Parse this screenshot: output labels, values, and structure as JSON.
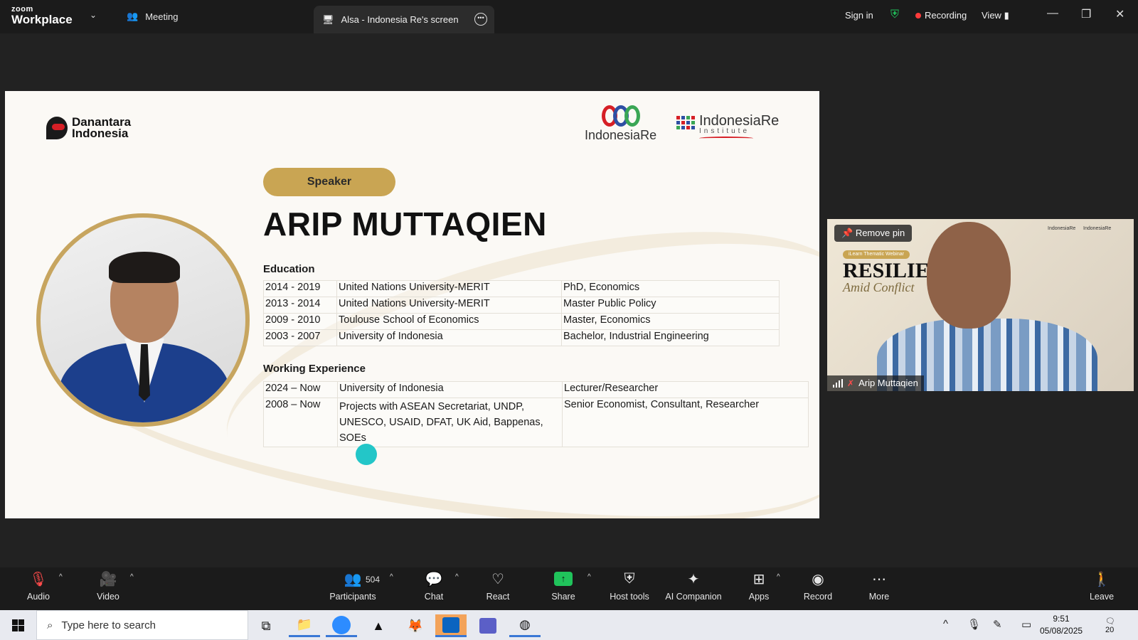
{
  "app": {
    "brand_top": "zoom",
    "brand_bottom": "Workplace",
    "meeting_tab": "Meeting",
    "screen_tab": "Alsa - Indonesia Re's screen",
    "sign_in": "Sign in",
    "recording": "Recording",
    "view": "View"
  },
  "slide": {
    "logo_danantara_line1": "Danantara",
    "logo_danantara_line2": "Indonesia",
    "logo_ire": "IndonesiaRe",
    "logo_inst_line1": "IndonesiaRe",
    "logo_inst_line2": "Institute",
    "speaker_badge": "Speaker",
    "speaker_name": "ARIP MUTTAQIEN",
    "education_title": "Education",
    "education": [
      {
        "years": "2014 - 2019",
        "school": "United Nations University-MERIT",
        "degree": "PhD, Economics"
      },
      {
        "years": "2013 - 2014",
        "school": "United Nations University-MERIT",
        "degree": "Master Public Policy"
      },
      {
        "years": "2009 - 2010",
        "school": "Toulouse School of Economics",
        "degree": "Master, Economics"
      },
      {
        "years": "2003 - 2007",
        "school": "University of Indonesia",
        "degree": "Bachelor, Industrial Engineering"
      }
    ],
    "work_title": "Working Experience",
    "work": [
      {
        "years": "2024 – Now",
        "org": "University of Indonesia",
        "role": "Lecturer/Researcher"
      },
      {
        "years": "2008 – Now",
        "org": "Projects with ASEAN Secretariat, UNDP, UNESCO, USAID, DFAT, UK Aid, Bappenas, SOEs",
        "role": "Senior Economist, Consultant, Researcher"
      }
    ]
  },
  "video_tile": {
    "remove_pin": "Remove pin",
    "badge": "iLearn Thematic Webinar",
    "title": "RESILIE",
    "subtitle": "Amid Conflict",
    "logo1": "IndonesiaRe",
    "logo2": "IndonesiaRe",
    "participant_name": "Arip Muttaqien"
  },
  "toolbar": {
    "audio": "Audio",
    "video": "Video",
    "participants": "Participants",
    "participants_count": "504",
    "chat": "Chat",
    "react": "React",
    "share": "Share",
    "host_tools": "Host tools",
    "ai_companion": "AI Companion",
    "apps": "Apps",
    "record": "Record",
    "more": "More",
    "leave": "Leave"
  },
  "taskbar": {
    "search_placeholder": "Type here to search",
    "time": "9:51",
    "date": "05/08/2025",
    "notifications": "20"
  },
  "colors": {
    "accent_gold": "#c9a553",
    "share_green": "#20c35b",
    "recording_red": "#ff3b3b",
    "pointer_teal": "#23c6c8"
  }
}
